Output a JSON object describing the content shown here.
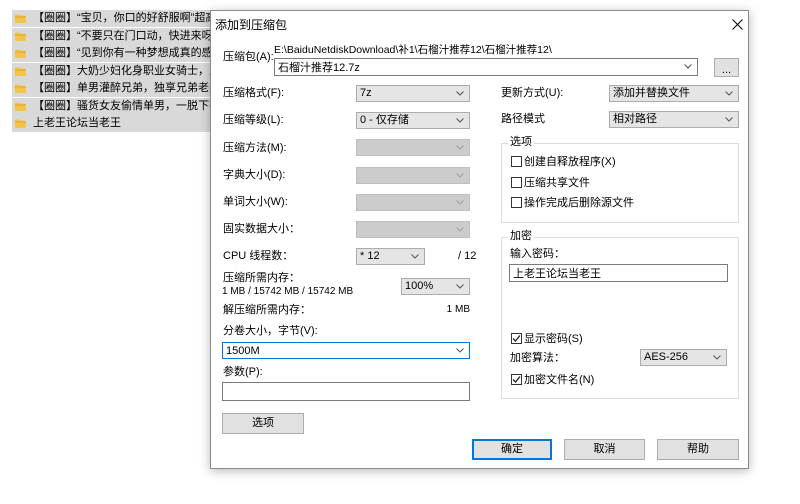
{
  "file_list": {
    "items": [
      {
        "name": "【圈圈】“宝贝，你口的好舒服啊”超高颜...",
        "icon": "folder-icon"
      },
      {
        "name": "【圈圈】“不要只在门口动，快进来呀”极...",
        "icon": "folder-icon"
      },
      {
        "name": "【圈圈】“见到你有一种梦想成真的感觉”...",
        "icon": "folder-icon"
      },
      {
        "name": "【圈圈】大奶少妇化身职业女骑士，上位...",
        "icon": "folder-icon"
      },
      {
        "name": "【圈圈】单男灌醉兄弟，独享兄弟老婆，...",
        "icon": "folder-icon"
      },
      {
        "name": "【圈圈】骚货女友偷情单男，一脱下衣服...",
        "icon": "folder-icon"
      },
      {
        "name": "上老王论坛当老王",
        "icon": "folder-icon"
      }
    ]
  },
  "dialog": {
    "title": "添加到压缩包",
    "close_icon": "close-icon",
    "archive": {
      "label": "压缩包(A):",
      "path": "E:\\BaiduNetdiskDownload\\补1\\石榴汁推荐12\\石榴汁推荐12\\",
      "name": "石榴汁推荐12.7z",
      "browse_label": "..."
    },
    "format": {
      "label": "压缩格式(F):",
      "value": "7z"
    },
    "level": {
      "label": "压缩等级(L):",
      "value": "0 - 仅存储"
    },
    "method": {
      "label": "压缩方法(M):",
      "disabled": true
    },
    "dictionary": {
      "label": "字典大小(D):",
      "disabled": true
    },
    "word_size": {
      "label": "单词大小(W):",
      "disabled": true
    },
    "solid_block": {
      "label": "固实数据大小：",
      "disabled": true
    },
    "cpu_threads": {
      "label": "CPU 线程数：",
      "value": "* 12",
      "max": "/ 12"
    },
    "compress_memory": {
      "label": "压缩所需内存：",
      "value": "1 MB / 15742 MB / 15742 MB",
      "percent": "100%"
    },
    "decompress_memory": {
      "label": "解压缩所需内存：",
      "value": "1 MB"
    },
    "split_volume": {
      "label": "分卷大小，字节(V):",
      "value": "1500M"
    },
    "parameters": {
      "label": "参数(P):",
      "value": ""
    },
    "options_button": "选项",
    "update_mode": {
      "label": "更新方式(U):",
      "value": "添加并替换文件"
    },
    "path_mode": {
      "label": "路径模式",
      "value": "相对路径"
    },
    "options_group": {
      "title": "选项",
      "checkboxes": [
        {
          "label": "创建自释放程序(X)",
          "checked": false
        },
        {
          "label": "压缩共享文件",
          "checked": false
        },
        {
          "label": "操作完成后删除源文件",
          "checked": false
        }
      ]
    },
    "encryption_group": {
      "title": "加密",
      "password_label": "输入密码：",
      "password": "上老王论坛当老王",
      "show_password": {
        "label": "显示密码(S)",
        "checked": true
      },
      "method_label": "加密算法：",
      "method": "AES-256",
      "encrypt_names": {
        "label": "加密文件名(N)",
        "checked": true
      }
    },
    "buttons": {
      "ok": "确定",
      "cancel": "取消",
      "help": "帮助"
    }
  },
  "colors": {
    "accent": "#0078d7",
    "row_selection": "#d9d9d9",
    "folder": "#f4c34a"
  }
}
